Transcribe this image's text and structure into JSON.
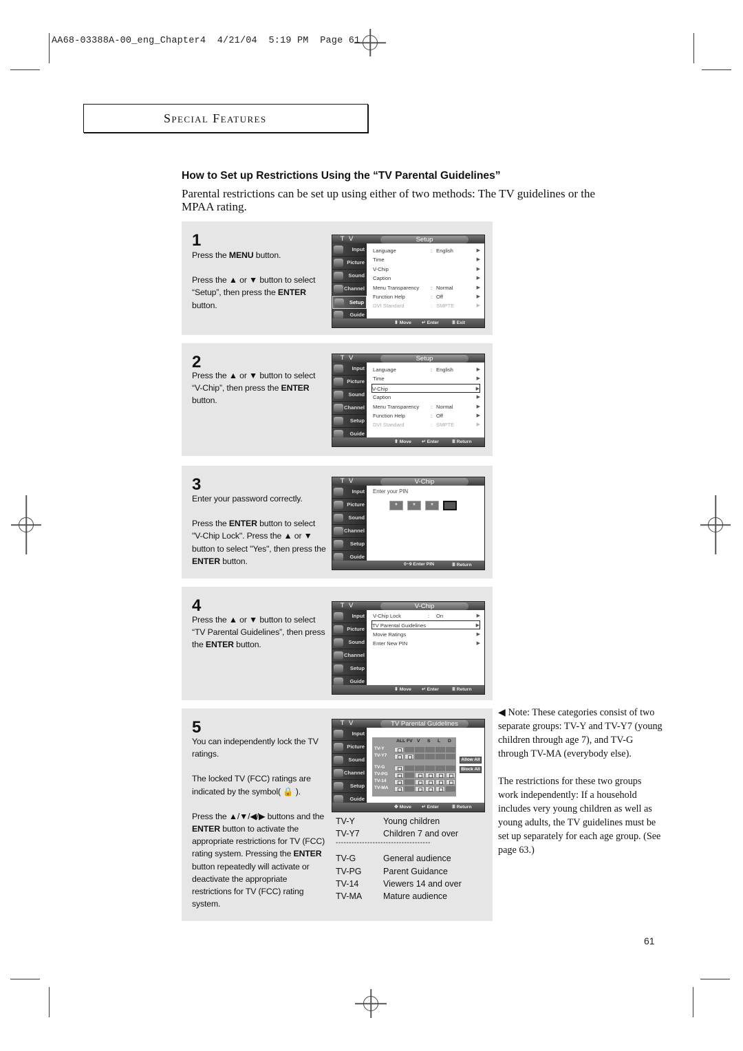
{
  "slug": {
    "file": "AA68-03388A-00_eng_Chapter4",
    "date": "4/21/04",
    "time": "5:19 PM",
    "page_label": "Page",
    "page": "61"
  },
  "section_title": "Special Features",
  "heading": "How to Set up Restrictions Using the “TV Parental Guidelines”",
  "intro": "Parental restrictions can be set up using either of two methods: The TV guidelines or the MPAA rating.",
  "menu_sidebar": [
    "Input",
    "Picture",
    "Sound",
    "Channel",
    "Setup",
    "Guide"
  ],
  "osd_tv_label": "T V",
  "steps": [
    {
      "number": "1",
      "para1": [
        "Press the ",
        "MENU",
        " button."
      ],
      "para2": [
        "Press the ▲ or ▼ button to select “Setup”, then press the ",
        "ENTER",
        " button."
      ],
      "screen": {
        "title": "Setup",
        "rows": [
          {
            "key": "Language",
            "value": "English",
            "arrow": "▶"
          },
          {
            "key": "Time",
            "value": "",
            "arrow": "▶"
          },
          {
            "key": "V-Chip",
            "value": "",
            "arrow": "▶"
          },
          {
            "key": "Caption",
            "value": "",
            "arrow": "▶"
          },
          {
            "key": "Menu Transparency",
            "value": "Normal",
            "arrow": "▶"
          },
          {
            "key": "Function Help",
            "value": "Off",
            "arrow": "▶"
          },
          {
            "key": "DVI Standard",
            "value": "SMPTE",
            "arrow": "▶"
          }
        ],
        "footer": {
          "move": "⬍ Move",
          "enter": "↵ Enter",
          "exit": "Ⅲ Exit"
        }
      }
    },
    {
      "number": "2",
      "para1": [
        "Press the ▲ or ▼ button to select “V-Chip”, then press the ",
        "ENTER",
        " button."
      ],
      "screen": {
        "title": "Setup",
        "rows": [
          {
            "key": "Language",
            "value": "English",
            "arrow": "▶"
          },
          {
            "key": "Time",
            "value": "",
            "arrow": "▶"
          },
          {
            "key": "V-Chip",
            "value": "",
            "arrow": "▶"
          },
          {
            "key": "Caption",
            "value": "",
            "arrow": "▶"
          },
          {
            "key": "Menu Transparency",
            "value": "Normal",
            "arrow": "▶"
          },
          {
            "key": "Function Help",
            "value": "Off",
            "arrow": "▶"
          },
          {
            "key": "DVI Standard",
            "value": "SMPTE",
            "arrow": "▶"
          }
        ],
        "footer": {
          "move": "⬍ Move",
          "enter": "↵ Enter",
          "exit": "Ⅲ Return"
        }
      }
    },
    {
      "number": "3",
      "para1": [
        "Enter your password correctly."
      ],
      "para2": [
        "Press the ",
        "ENTER",
        " button to select \"V-Chip Lock\". Press the ▲ or ▼ button to select \"Yes\", then press the ",
        "ENTER",
        " button."
      ],
      "screen": {
        "title": "V-Chip",
        "pin_label": "Enter your PIN",
        "pin": [
          "*",
          "*",
          "*",
          ""
        ],
        "footer": {
          "enter": "0~9 Enter PIN",
          "exit": "Ⅲ Return"
        }
      }
    },
    {
      "number": "4",
      "para1": [
        "Press the ▲ or ▼ button to select “TV Parental Guidelines”, then press the ",
        "ENTER",
        " button."
      ],
      "screen": {
        "title": "V-Chip",
        "rows": [
          {
            "key": "V-Chip Lock",
            "value": "On",
            "arrow": "▶"
          },
          {
            "key": "TV Parental Guidelines",
            "value": "",
            "arrow": "▶"
          },
          {
            "key": "Movie Ratings",
            "value": "",
            "arrow": "▶"
          },
          {
            "key": "Enter New PIN",
            "value": "",
            "arrow": "▶"
          }
        ],
        "footer": {
          "move": "⬍ Move",
          "enter": "↵ Enter",
          "exit": "Ⅲ Return"
        }
      }
    },
    {
      "number": "5",
      "para1": [
        "You can independently lock the TV ratings."
      ],
      "para2": [
        "The locked TV (FCC) ratings are indicated by the symbol( 🔒 )."
      ],
      "para3": [
        "Press the ▲/▼/◀/▶ buttons and the ",
        "ENTER",
        " button to activate the appropriate restrictions for TV (FCC) rating system. Pressing the ",
        "ENTER",
        " button repeatedly will activate or deactivate the appropriate restrictions for TV (FCC) rating system."
      ],
      "screen": {
        "title": "TV Parental Guidelines",
        "columns": [
          "ALL",
          "FV",
          "V",
          "S",
          "L",
          "D"
        ],
        "ratings": [
          {
            "name": "TV-Y",
            "locks": [
              1,
              0,
              0,
              0,
              0,
              0
            ]
          },
          {
            "name": "TV-Y7",
            "locks": [
              1,
              1,
              0,
              0,
              0,
              0
            ]
          },
          {
            "name": "TV-G",
            "locks": [
              1,
              0,
              0,
              0,
              0,
              0
            ]
          },
          {
            "name": "TV-PG",
            "locks": [
              1,
              0,
              1,
              1,
              1,
              1
            ]
          },
          {
            "name": "TV-14",
            "locks": [
              1,
              0,
              1,
              1,
              1,
              1
            ]
          },
          {
            "name": "TV-MA",
            "locks": [
              1,
              0,
              1,
              1,
              1,
              0
            ]
          }
        ],
        "buttons": [
          "Allow All",
          "Block All"
        ],
        "footer": {
          "move": "✥ Move",
          "enter": "↵ Enter",
          "exit": "Ⅲ Return"
        }
      },
      "legend": {
        "group1": [
          {
            "code": "TV-Y",
            "desc": "Young children"
          },
          {
            "code": "TV-Y7",
            "desc": "Children 7 and over"
          }
        ],
        "separator": "------------------------------------",
        "group2": [
          {
            "code": "TV-G",
            "desc": "General audience"
          },
          {
            "code": "TV-PG",
            "desc": "Parent Guidance"
          },
          {
            "code": "TV-14",
            "desc": "Viewers 14 and over"
          },
          {
            "code": "TV-MA",
            "desc": "Mature audience"
          }
        ]
      }
    }
  ],
  "note": {
    "p1": "◀ Note: These categories consist of two separate groups: TV-Y and TV-Y7 (young children through age 7), and TV-G through TV-MA (everybody else).",
    "p2": "The restrictions for these two groups work independently: If a household includes very young children as well as young adults, the TV guidelines must be set up separately for each age group. (See page 63.)"
  },
  "page_number": "61"
}
